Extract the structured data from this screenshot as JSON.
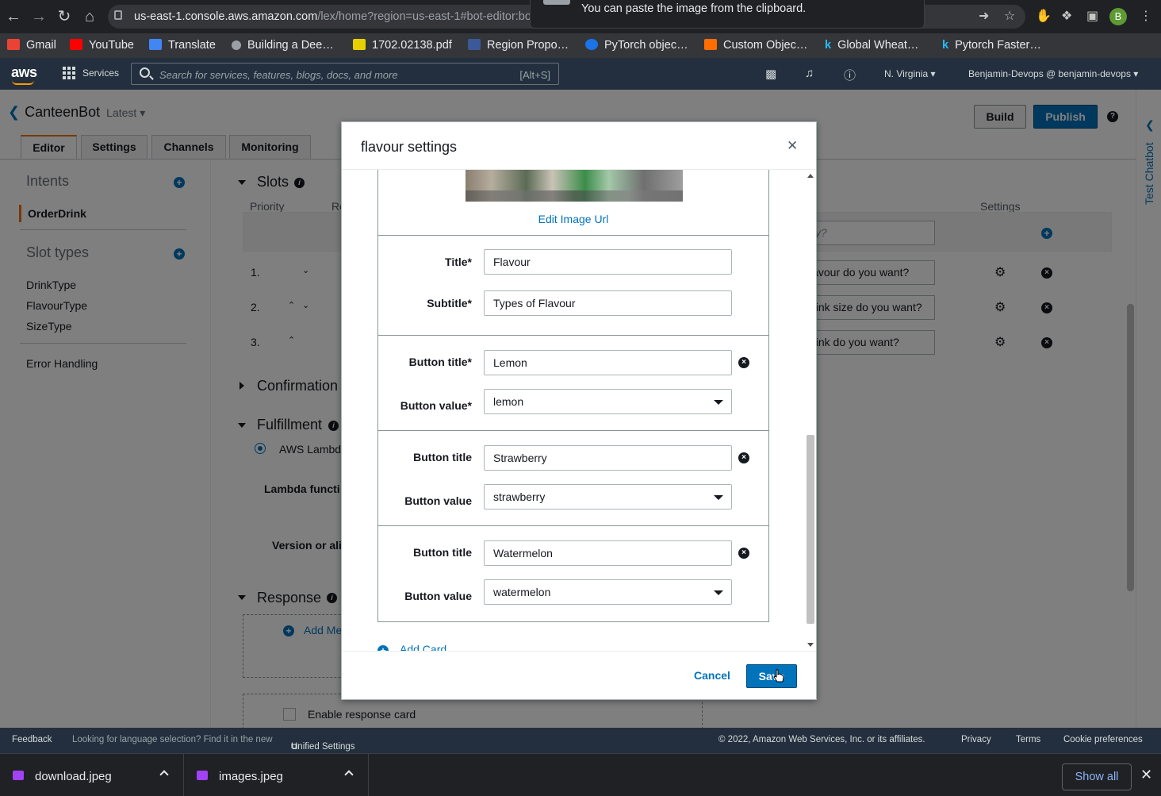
{
  "browser": {
    "url_host": "us-east-1.console.aws.amazon.com",
    "url_path": "/lex/home?region=us-east-1#bot-editor:bot=",
    "toast": "You can paste the image from the clipboard.",
    "profile_initial": "B",
    "bookmarks": [
      "Gmail",
      "YouTube",
      "Translate",
      "Building a Dee…",
      "1702.02138.pdf",
      "Region Propo…",
      "PyTorch objec…",
      "Custom Objec…",
      "Global Wheat…",
      "Pytorch Faster…"
    ]
  },
  "aws_header": {
    "logo": "aws",
    "services": "Services",
    "search_placeholder": "Search for services, features, blogs, docs, and more",
    "search_shortcut": "[Alt+S]",
    "region": "N. Virginia",
    "account": "Benjamin-Devops @ benjamin-devops"
  },
  "bot": {
    "name": "CanteenBot",
    "version": "Latest",
    "build": "Build",
    "publish": "Publish",
    "tabs": [
      "Editor",
      "Settings",
      "Channels",
      "Monitoring"
    ],
    "test_chatbot": "Test Chatbot"
  },
  "sidebar": {
    "intents": "Intents",
    "intent_items": [
      "OrderDrink"
    ],
    "slot_types": "Slot types",
    "slot_type_items": [
      "DrinkType",
      "FlavourType",
      "SizeType"
    ],
    "error_handling": "Error Handling"
  },
  "editor": {
    "slots": "Slots",
    "priority": "Priority",
    "req": "Re",
    "settings_col": "Settings",
    "new_slot_placeholder": "ity?",
    "rows": [
      "1.",
      "2.",
      "3."
    ],
    "prompts": [
      "lavour do you want?",
      "lrink size do you want?",
      "lrink do you want?"
    ],
    "confirmation": "Confirmation",
    "fulfillment": "Fulfillment",
    "aws_lambda": "AWS Lambd",
    "lambda_function": "Lambda functi",
    "version_alias": "Version or ali",
    "response": "Response",
    "add_message": "Add Me",
    "enable_response_card": "Enable response card"
  },
  "modal": {
    "title": "flavour settings",
    "edit_image_url": "Edit Image Url",
    "title_label": "Title*",
    "title_value": "Flavour",
    "subtitle_label": "Subtitle*",
    "subtitle_value": "Types of Flavour",
    "buttons": [
      {
        "title_label": "Button title*",
        "title": "Lemon",
        "value_label": "Button value*",
        "value": "lemon"
      },
      {
        "title_label": "Button title",
        "title": "Strawberry",
        "value_label": "Button value",
        "value": "strawberry"
      },
      {
        "title_label": "Button title",
        "title": "Watermelon",
        "value_label": "Button value",
        "value": "watermelon"
      }
    ],
    "add_card": "Add Card",
    "cancel": "Cancel",
    "save": "Save"
  },
  "footer": {
    "feedback": "Feedback",
    "language_note": "Looking for language selection? Find it in the new",
    "unified_settings": "Unified Settings",
    "copyright": "© 2022, Amazon Web Services, Inc. or its affiliates.",
    "privacy": "Privacy",
    "terms": "Terms",
    "cookies": "Cookie preferences"
  },
  "downloads": {
    "files": [
      "download.jpeg",
      "images.jpeg"
    ],
    "show_all": "Show all"
  }
}
